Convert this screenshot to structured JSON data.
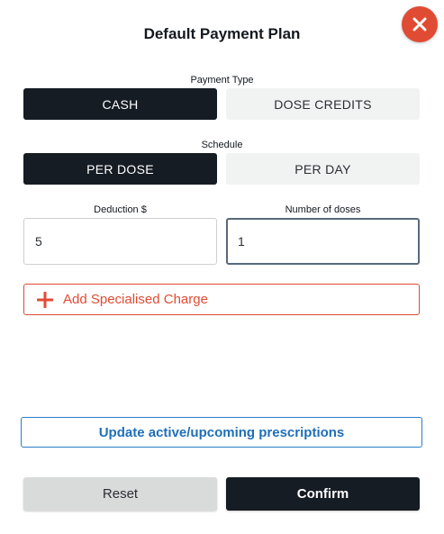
{
  "dialog": {
    "title": "Default Payment Plan"
  },
  "payment_type": {
    "label": "Payment Type",
    "options": [
      "CASH",
      "DOSE CREDITS"
    ],
    "selected": "CASH"
  },
  "schedule": {
    "label": "Schedule",
    "options": [
      "PER DOSE",
      "PER DAY"
    ],
    "selected": "PER DOSE"
  },
  "deduction": {
    "label": "Deduction $",
    "value": "5"
  },
  "doses": {
    "label": "Number of doses",
    "value": "1"
  },
  "specialised_charge": {
    "label": "Add Specialised Charge",
    "icon": "plus-icon"
  },
  "actions": {
    "update_label": "Update active/upcoming prescriptions",
    "reset_label": "Reset",
    "confirm_label": "Confirm"
  },
  "colors": {
    "accent_red": "#e04b34",
    "dark": "#161c24",
    "link_blue": "#1f6fb8",
    "inactive_bg": "#f1f2f2"
  },
  "icons": {
    "close": "close-icon",
    "add": "plus-icon"
  }
}
